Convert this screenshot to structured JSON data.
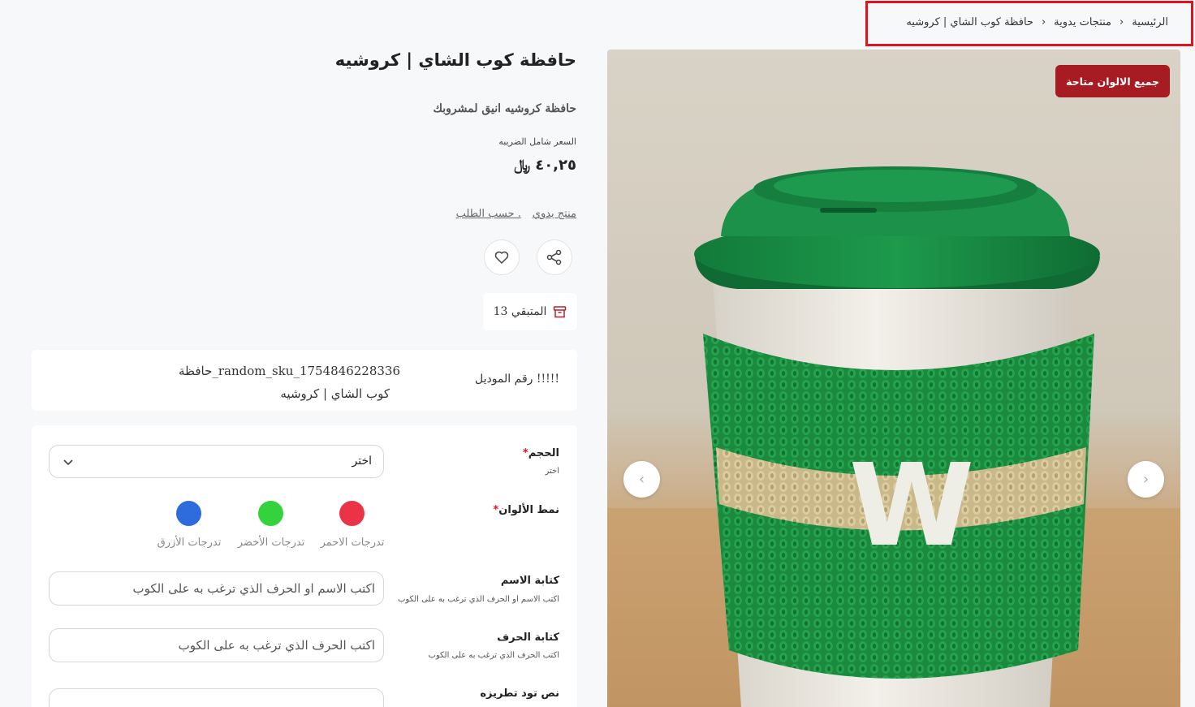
{
  "breadcrumb": {
    "home": "الرئيسية",
    "category": "منتجات يدوية",
    "current": "حافظة كوب الشاي | كروشيه",
    "separator": "›"
  },
  "product": {
    "title": "حافظة كوب الشاي | كروشيه",
    "subtitle": "حافظة كروشيه انيق لمشروبك",
    "tax_note": "السعر شامل الضريبه",
    "price": "٤٠,٢٥",
    "currency": "﷼",
    "tags": [
      "منتج يدوي",
      "حسب الطلب ."
    ],
    "badge": "جميع الالوان متاحة",
    "stock_label": "المتبقي 13"
  },
  "model": {
    "label": "رقم الموديل !!!!!",
    "value_line1": "حافظة_random_sku_1754846228336",
    "value_line2": "كوب الشاي | كروشيه"
  },
  "options": {
    "size": {
      "label": "الحجم",
      "hint": "اختر",
      "selected": "اختر"
    },
    "colors": {
      "label": "نمط الألوان",
      "items": [
        {
          "label": "تدرجات الاحمر",
          "color": "#ea3347"
        },
        {
          "label": "تدرجات الأخضر",
          "color": "#33d33d"
        },
        {
          "label": "تدرجات الأزرق",
          "color": "#2e6bdc"
        }
      ]
    },
    "name": {
      "label": "كتابة الاسم",
      "hint": "اكتب الاسم او الحرف الذي ترغب به على الكوب",
      "placeholder": "اكتب الاسم او الحرف الذي ترغب به على الكوب"
    },
    "letter": {
      "label": "كتابة الحرف",
      "hint": "اكتب الحرف الذي ترغب به على الكوب",
      "placeholder": "اكتب الحرف الذي ترغب به على الكوب"
    },
    "embroidery": {
      "label": "نص تود تطريزه"
    }
  },
  "image": {
    "alt_letter": "W",
    "prev_icon": "chevron-left-icon",
    "next_icon": "chevron-right-icon"
  },
  "colors": {
    "badge": "#a71b22",
    "highlight_border": "#e0141e"
  }
}
